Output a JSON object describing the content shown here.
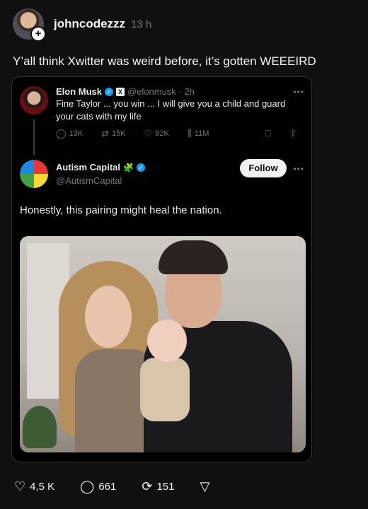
{
  "post": {
    "username": "johncodezzz",
    "time": "13 h",
    "text": "Y’all think Xwitter was weird before, it’s gotten WEEEIRD"
  },
  "tweet1": {
    "name": "Elon Musk",
    "handle": "@elonmusk · 2h",
    "text": "Fine Taylor ... you win ... I will give you a child and guard your cats with my life",
    "replies": "13K",
    "reposts": "15K",
    "likes": "82K",
    "views": "11M"
  },
  "tweet2": {
    "name": "Autism Capital",
    "handle": "@AutismCapital",
    "follow_label": "Follow",
    "text": "Honestly, this pairing might heal the nation."
  },
  "actions": {
    "likes": "4,5 K",
    "comments": "661",
    "reposts": "151"
  },
  "colors": {
    "background": "#101010",
    "card": "#000000",
    "verified": "#1d9bf0",
    "muted": "#71767b"
  }
}
